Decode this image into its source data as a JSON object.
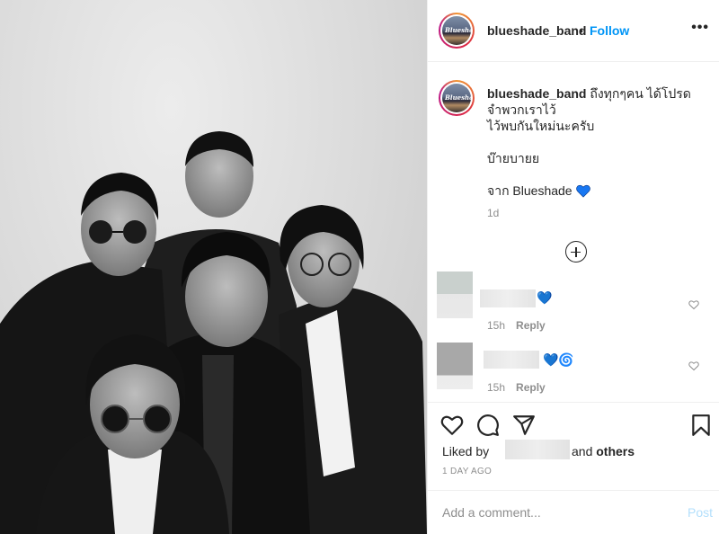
{
  "post": {
    "username": "blueshade_band",
    "follow_label": "Follow",
    "dot": "•",
    "more_label": "•••",
    "avatar_text": "Blueshade"
  },
  "caption": {
    "username": "blueshade_band",
    "line1": "ถึงทุกๆคน ได้โปรดจำพวกเราไว้",
    "line2": "ไว้พบกันใหม่นะครับ",
    "line3": "บ๊ายบายย",
    "line4": "จาก Blueshade",
    "time": "1d"
  },
  "comments": [
    {
      "emoji": "💙",
      "time": "15h",
      "reply_label": "Reply"
    },
    {
      "emoji": "💙🌀",
      "time": "15h",
      "reply_label": "Reply"
    }
  ],
  "actions": {
    "liked_by_label": "Liked by",
    "and_label": "and",
    "others_label": "others",
    "post_age": "1 DAY AGO"
  },
  "composer": {
    "placeholder": "Add a comment...",
    "post_label": "Post"
  },
  "colors": {
    "accent": "#0095f6",
    "muted": "#8e8e8e",
    "heart_blue": "#1877f2"
  }
}
